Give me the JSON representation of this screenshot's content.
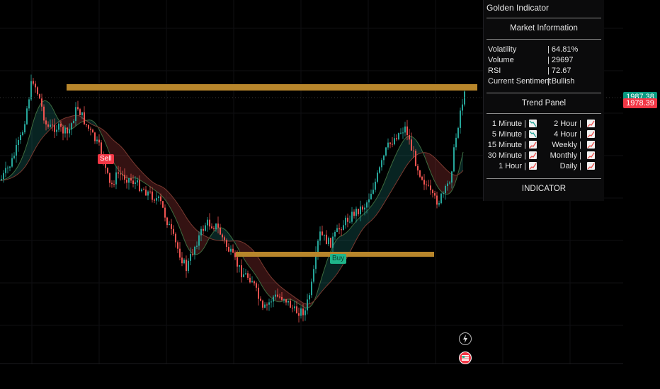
{
  "panel": {
    "title": "Golden Indicator",
    "market_header": "Market Information",
    "info": [
      {
        "key": "Volatility",
        "value": "| 64.81%"
      },
      {
        "key": "Volume",
        "value": "| 29697"
      },
      {
        "key": "RSI",
        "value": "| 72.67"
      },
      {
        "key": "Current Sentiment",
        "value": "| Bullish"
      }
    ],
    "trend_header": "Trend Panel",
    "trend": [
      {
        "left": "1 Minute |",
        "left_trend": "down",
        "right": "2 Hour |",
        "right_trend": "up"
      },
      {
        "left": "5 Minute |",
        "left_trend": "down",
        "right": "4 Hour |",
        "right_trend": "up"
      },
      {
        "left": "15 Minute |",
        "left_trend": "up",
        "right": "Weekly |",
        "right_trend": "up"
      },
      {
        "left": "30 Minute |",
        "left_trend": "up",
        "right": "Monthly |",
        "right_trend": "up"
      },
      {
        "left": "1 Hour |",
        "left_trend": "up",
        "right": "Daily |",
        "right_trend": "up"
      }
    ],
    "footer": "INDICATOR"
  },
  "price_tags": {
    "current": "1978.39",
    "other": "1987.38"
  },
  "signals": {
    "sell_label": "Sell",
    "buy_label": "Buy"
  },
  "colors": {
    "bull": "#26a69a",
    "bear": "#ef5350",
    "gold": "#b8862b",
    "sell_badge": "#f23645",
    "buy_badge": "#1fb58a"
  },
  "icons": {
    "lightning": "lightning-icon",
    "flag": "flag-icon",
    "trend_up": "trend-up-icon",
    "trend_down": "trend-down-icon"
  }
}
